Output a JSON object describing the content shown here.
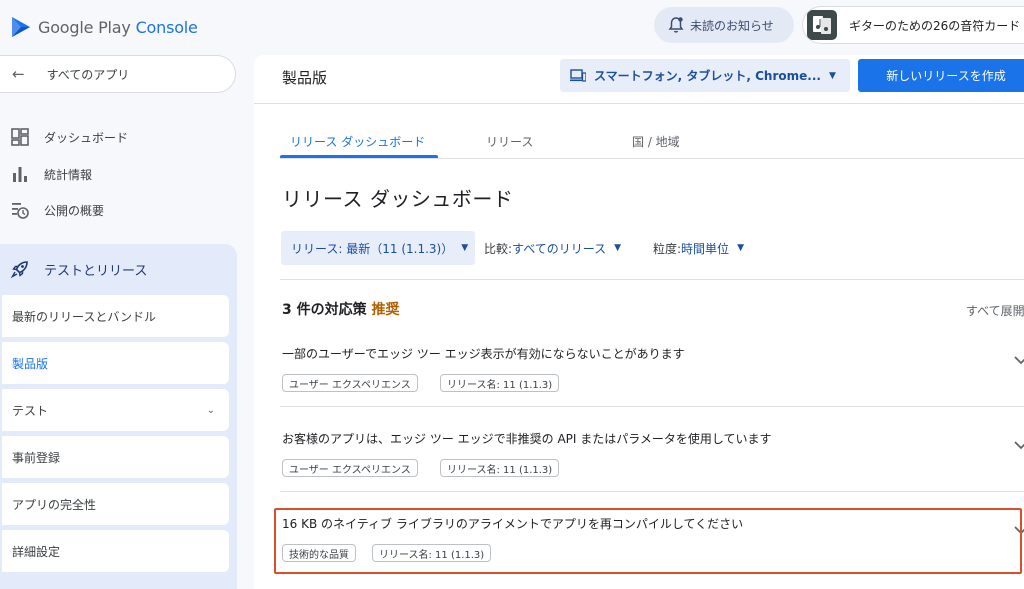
{
  "brand": {
    "google_play": "Google Play",
    "console": "Console",
    "logo_icon": "play-console-logo"
  },
  "header": {
    "notifications_label": "未読のお知らせ",
    "notifications_icon": "bell-alert-icon",
    "app_name": "ギターのための26の音符カード",
    "app_icon": "guitar-notes-app-icon"
  },
  "sidebar": {
    "back_label": "すべてのアプリ",
    "items": [
      {
        "label": "ダッシュボード",
        "icon": "dashboard-icon"
      },
      {
        "label": "統計情報",
        "icon": "bar-chart-icon"
      },
      {
        "label": "公開の概要",
        "icon": "publishing-overview-icon"
      }
    ],
    "section": {
      "label": "テストとリリース",
      "icon": "rocket-icon",
      "items": [
        {
          "label": "最新のリリースとバンドル"
        },
        {
          "label": "製品版",
          "active": true
        },
        {
          "label": "テスト",
          "expandable": true
        },
        {
          "label": "事前登録"
        },
        {
          "label": "アプリの完全性"
        },
        {
          "label": "詳細設定"
        }
      ]
    }
  },
  "main": {
    "page_title": "製品版",
    "device_selector": "スマートフォン, タブレット, Chrome...",
    "create_release_button": "新しいリリースを作成",
    "tabs": [
      {
        "label": "リリース ダッシュボード",
        "active": true
      },
      {
        "label": "リリース"
      },
      {
        "label": "国 / 地域"
      }
    ],
    "heading": "リリース ダッシュボード",
    "filters": {
      "release": "リリース: 最新（11 (1.1.3)）",
      "compare_prefix": "比較: ",
      "compare_value": "すべてのリリース",
      "granularity_prefix": "粒度: ",
      "granularity_value": "時間単位"
    },
    "actions": {
      "count_title": "3 件の対応策",
      "recommended": "推奨",
      "expand_all": "すべて展開",
      "issues": [
        {
          "title": "一部のユーザーでエッジ ツー エッジ表示が有効にならないことがあります",
          "tags": [
            "ユーザー エクスペリエンス",
            "リリース名: 11 (1.1.3)"
          ]
        },
        {
          "title": "お客様のアプリは、エッジ ツー エッジで非推奨の API またはパラメータを使用しています",
          "tags": [
            "ユーザー エクスペリエンス",
            "リリース名: 11 (1.1.3)"
          ]
        },
        {
          "title": "16 KB のネイティブ ライブラリのアライメントでアプリを再コンパイルしてください",
          "tags": [
            "技術的な品質",
            "リリース名: 11 (1.1.3)"
          ],
          "highlighted": true
        }
      ]
    }
  },
  "colors": {
    "accent": "#1a73e8",
    "highlight_border": "#d9502b",
    "recommended": "#b06000",
    "section_bg": "#e3ebfb"
  }
}
